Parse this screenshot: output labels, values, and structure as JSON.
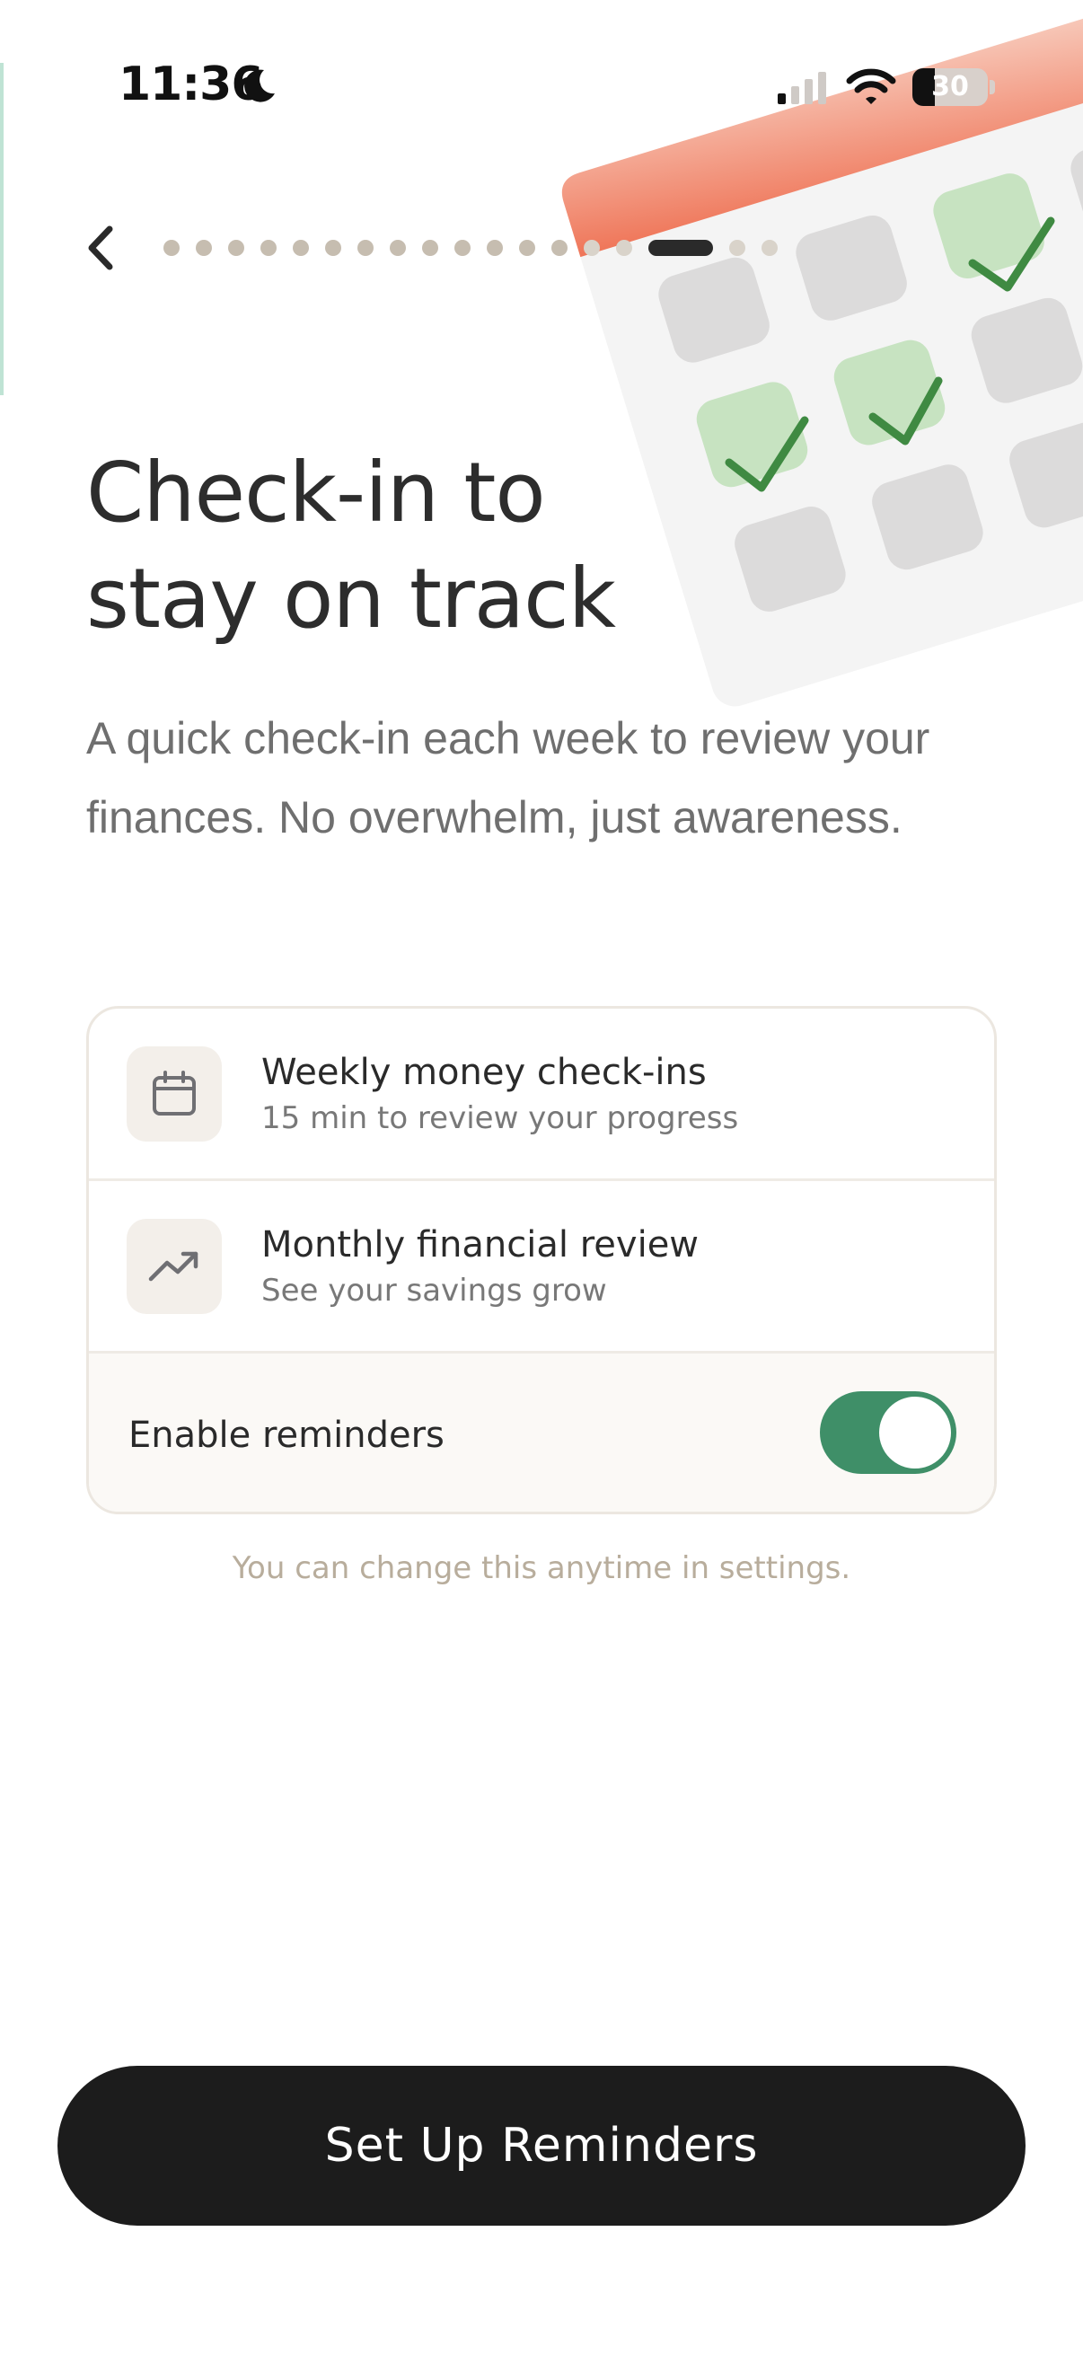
{
  "status_bar": {
    "time": "11:36",
    "battery_percent": "30",
    "icons": [
      "moon-icon",
      "signal-icon",
      "wifi-icon",
      "battery-icon"
    ]
  },
  "nav": {
    "back_icon": "chevron-left-icon",
    "progress_total_steps": 18,
    "progress_current_step": 16
  },
  "illustration": {
    "name": "calendar-illustration",
    "accent_color": "#f07c60",
    "check_color": "#3f8a42"
  },
  "header": {
    "title": "Check-in to stay on track",
    "subtitle": "A quick check-in each week to review your finances. No overwhelm, just awareness."
  },
  "features": [
    {
      "icon": "calendar-icon",
      "title": "Weekly money check-ins",
      "subtitle": "15 min to review your progress"
    },
    {
      "icon": "trending-up-icon",
      "title": "Monthly financial review",
      "subtitle": "See your savings grow"
    }
  ],
  "reminders": {
    "label": "Enable reminders",
    "enabled": true,
    "toggle_color": "#3f8f68"
  },
  "note": "You can change this anytime in settings.",
  "cta": {
    "label": "Set Up Reminders"
  }
}
